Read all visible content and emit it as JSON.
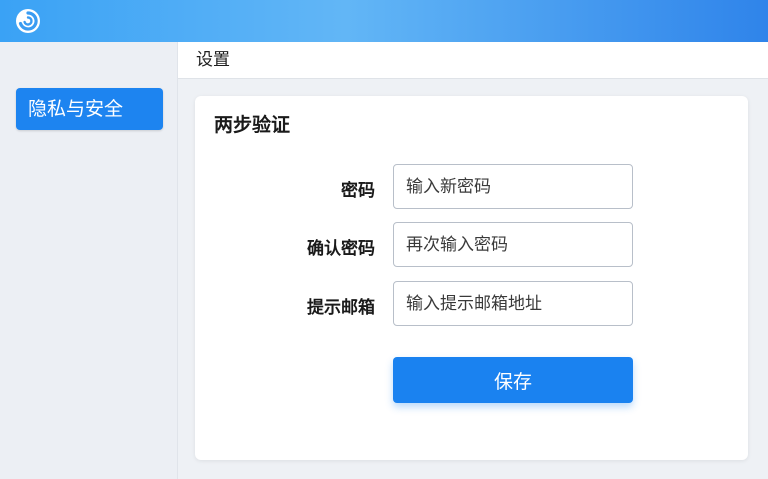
{
  "sidebar": {
    "items": [
      {
        "label": "隐私与安全",
        "active": true
      }
    ]
  },
  "header": {
    "title": "设置"
  },
  "card": {
    "title": "两步验证",
    "fields": [
      {
        "label": "密码",
        "placeholder": "输入新密码",
        "value": ""
      },
      {
        "label": "确认密码",
        "placeholder": "再次输入密码",
        "value": ""
      },
      {
        "label": "提示邮箱",
        "placeholder": "输入提示邮箱地址",
        "value": ""
      }
    ],
    "save_label": "保存"
  },
  "colors": {
    "accent": "#1d84f0",
    "topbar_start": "#3aa2f5",
    "topbar_end": "#2f84ea",
    "background": "#eef1f5"
  },
  "icons": {
    "app_logo": "app-logo-icon"
  }
}
